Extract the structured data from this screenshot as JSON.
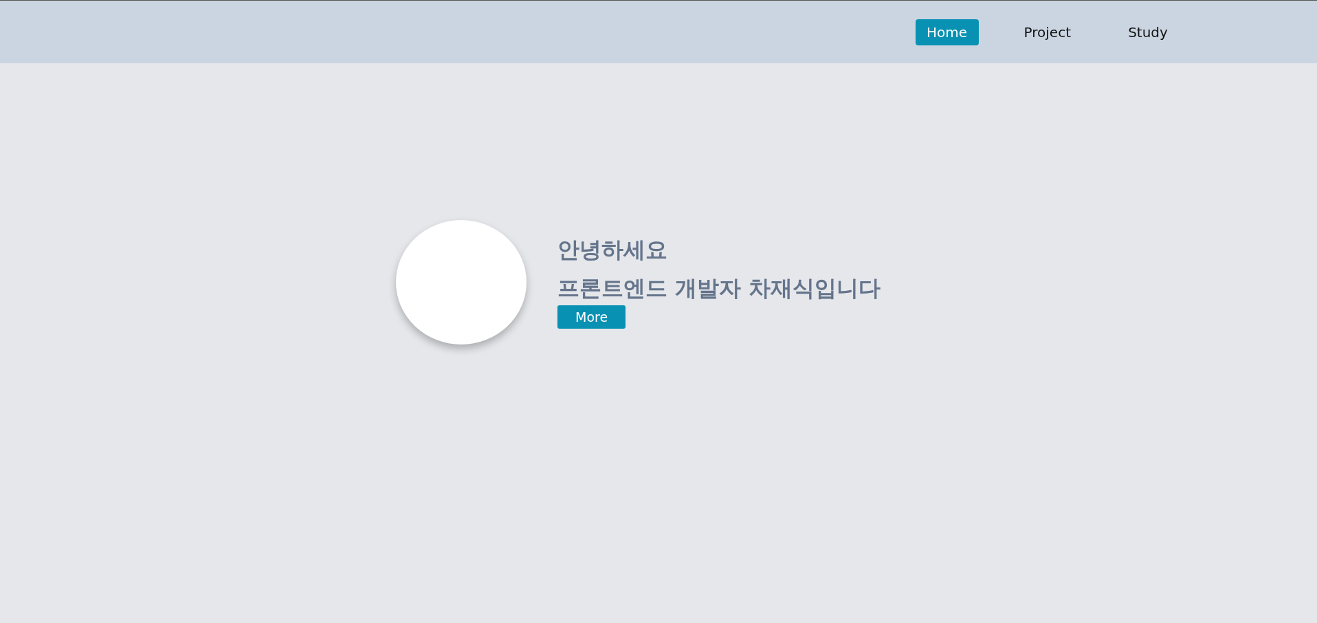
{
  "nav": {
    "items": [
      {
        "label": "Home",
        "selected": true
      },
      {
        "label": "Project",
        "selected": false
      },
      {
        "label": "Study",
        "selected": false
      }
    ]
  },
  "hero": {
    "greeting": "안녕하세요",
    "intro": "프론트엔드 개발자 차재식입니다",
    "button": "More"
  }
}
